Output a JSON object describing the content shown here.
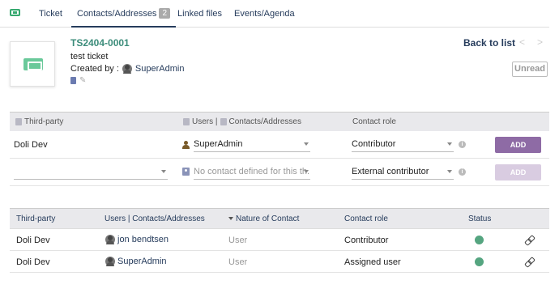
{
  "tabs": [
    {
      "label": "Ticket"
    },
    {
      "label": "Contacts/Addresses",
      "count": "2"
    },
    {
      "label": "Linked files"
    },
    {
      "label": "Events/Agenda"
    }
  ],
  "header": {
    "ref": "TS2404-0001",
    "label": "test ticket",
    "created_by_prefix": "Created by :",
    "creator": "SuperAdmin",
    "back_to_list": "Back to list",
    "prev": "<",
    "next": ">",
    "unread_button": "Unread"
  },
  "add_form": {
    "headers": {
      "third_party": "Third-party",
      "users_contacts": "Users | Contacts/Addresses",
      "users_part": "Users |",
      "contacts_part": "Contacts/Addresses",
      "contact_role": "Contact role"
    },
    "row1": {
      "third_party": "Doli Dev",
      "user_select": "SuperAdmin",
      "role_select": "Contributor",
      "add_label": "ADD"
    },
    "row2": {
      "third_party_select": "",
      "contact_placeholder": "No contact defined for this th...",
      "role_select": "External contributor",
      "add_label": "ADD"
    }
  },
  "list": {
    "headers": {
      "third_party": "Third-party",
      "users_contacts": "Users | Contacts/Addresses",
      "nature": "Nature of Contact",
      "role": "Contact role",
      "status": "Status"
    },
    "rows": [
      {
        "third_party": "Doli Dev",
        "contact": "jon bendtsen",
        "nature": "User",
        "role": "Contributor",
        "status": "active"
      },
      {
        "third_party": "Doli Dev",
        "contact": "SuperAdmin",
        "nature": "User",
        "role": "Assigned user",
        "status": "active"
      }
    ]
  },
  "colors": {
    "accent": "#263c5c",
    "ref": "#3b8c7a",
    "add_button": "#8e6ba5",
    "status_active": "#55a580"
  }
}
